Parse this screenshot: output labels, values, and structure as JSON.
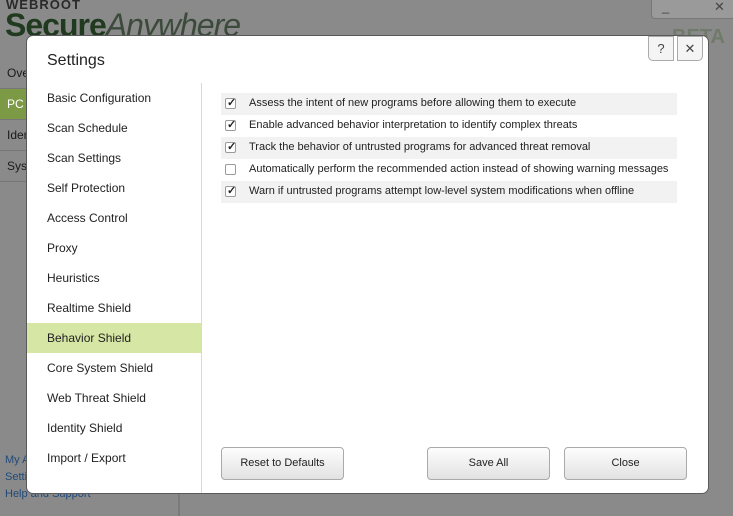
{
  "app": {
    "brand_small": "WEBROOT",
    "brand_big_bold": "Secure",
    "brand_big_light": "Anywhere",
    "beta": "BETA",
    "nav": [
      "Ove",
      "PC",
      "Iden",
      "Sys"
    ],
    "bottom_links": [
      "My A",
      "Setti",
      "Help and Support"
    ]
  },
  "dialog": {
    "title": "Settings",
    "help_icon": "?",
    "close_icon": "✕",
    "sidebar": [
      "Basic Configuration",
      "Scan Schedule",
      "Scan Settings",
      "Self Protection",
      "Access Control",
      "Proxy",
      "Heuristics",
      "Realtime Shield",
      "Behavior Shield",
      "Core System Shield",
      "Web Threat Shield",
      "Identity Shield",
      "Import / Export"
    ],
    "active_item": "Behavior Shield",
    "options": [
      {
        "label": "Assess the intent of new programs before allowing them to execute",
        "checked": true
      },
      {
        "label": "Enable advanced behavior interpretation to identify complex threats",
        "checked": true
      },
      {
        "label": "Track the behavior of untrusted programs for advanced threat removal",
        "checked": true
      },
      {
        "label": "Automatically perform the recommended action instead of showing warning messages",
        "checked": false
      },
      {
        "label": "Warn if untrusted programs attempt low-level system modifications when offline",
        "checked": true
      }
    ],
    "buttons": {
      "reset": "Reset to Defaults",
      "save_all": "Save All",
      "close": "Close"
    }
  }
}
